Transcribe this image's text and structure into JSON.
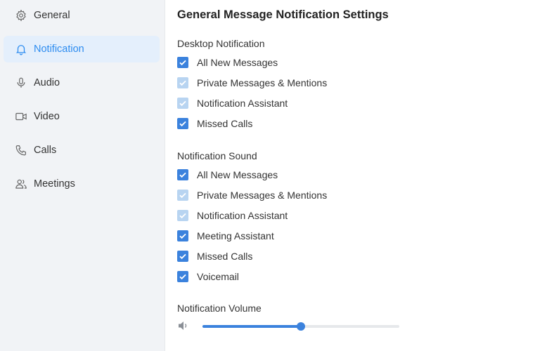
{
  "sidebar": {
    "items": [
      {
        "label": "General",
        "icon": "gear-icon"
      },
      {
        "label": "Notification",
        "icon": "bell-icon",
        "active": true
      },
      {
        "label": "Audio",
        "icon": "microphone-icon"
      },
      {
        "label": "Video",
        "icon": "video-camera-icon"
      },
      {
        "label": "Calls",
        "icon": "phone-icon"
      },
      {
        "label": "Meetings",
        "icon": "people-icon"
      }
    ]
  },
  "main": {
    "title": "General Message Notification Settings",
    "desktop_notification": {
      "label": "Desktop Notification",
      "options": [
        {
          "label": "All New Messages",
          "checked": true,
          "disabled": false
        },
        {
          "label": "Private Messages & Mentions",
          "checked": true,
          "disabled": true
        },
        {
          "label": "Notification Assistant",
          "checked": true,
          "disabled": true
        },
        {
          "label": "Missed Calls",
          "checked": true,
          "disabled": false
        }
      ]
    },
    "notification_sound": {
      "label": "Notification Sound",
      "options": [
        {
          "label": "All New Messages",
          "checked": true,
          "disabled": false
        },
        {
          "label": "Private Messages & Mentions",
          "checked": true,
          "disabled": true
        },
        {
          "label": "Notification Assistant",
          "checked": true,
          "disabled": true
        },
        {
          "label": "Meeting Assistant",
          "checked": true,
          "disabled": false
        },
        {
          "label": "Missed Calls",
          "checked": true,
          "disabled": false
        },
        {
          "label": "Voicemail",
          "checked": true,
          "disabled": false
        }
      ]
    },
    "volume": {
      "label": "Notification Volume",
      "icon": "speaker-icon",
      "value_fraction": 0.5
    }
  },
  "colors": {
    "accent": "#3b82dd",
    "accent_disabled": "#b8d4f1",
    "active_text": "#2d8cf0",
    "sidebar_bg": "#f1f3f6",
    "active_bg": "#e4effc"
  }
}
